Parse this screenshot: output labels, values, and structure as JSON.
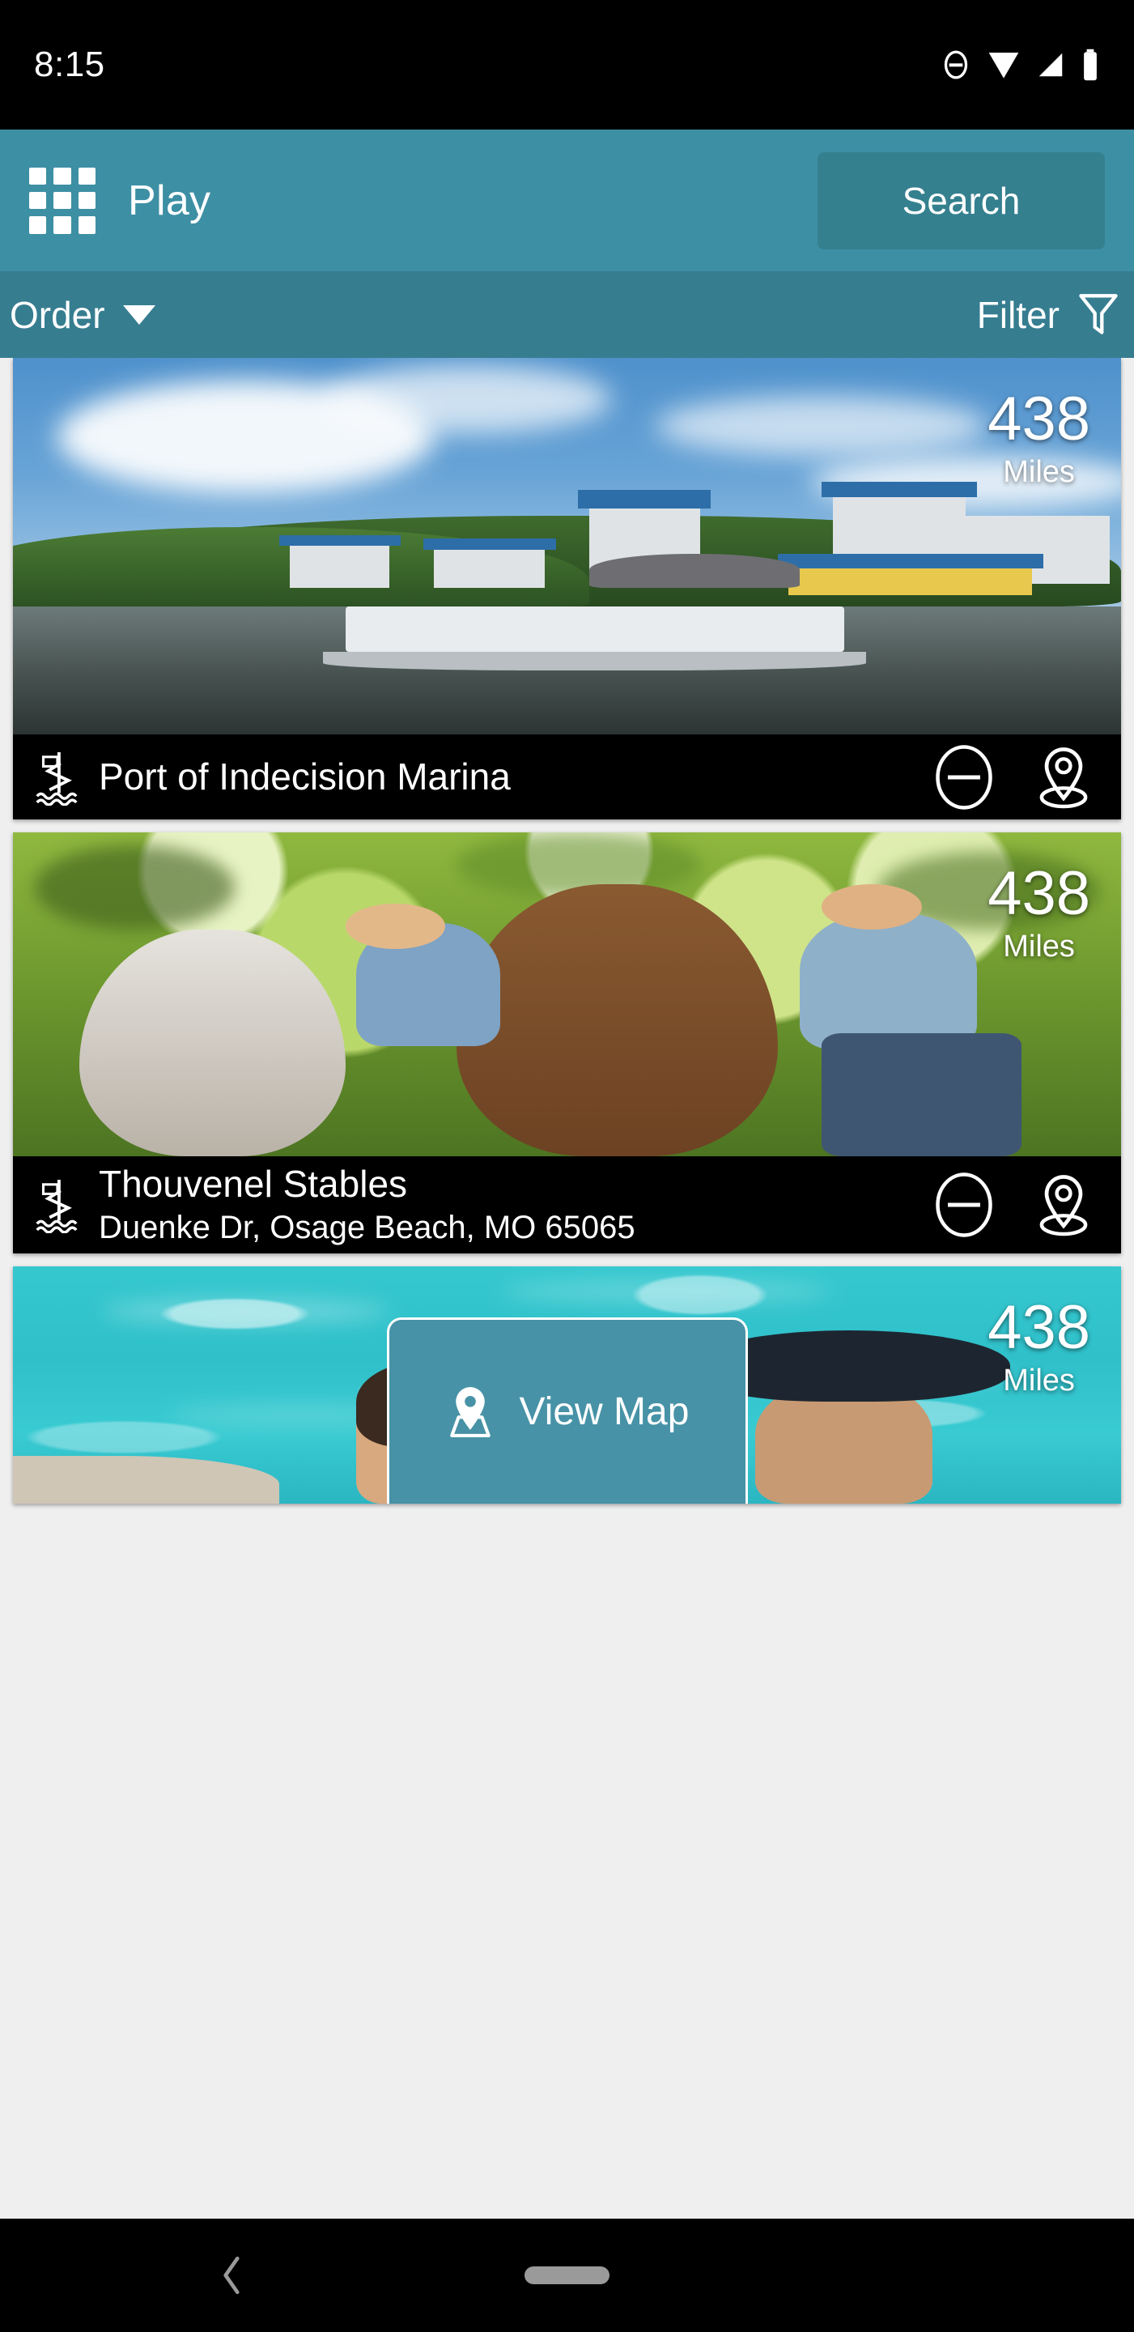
{
  "status_bar": {
    "time": "8:15",
    "icons": [
      "do-not-disturb-icon",
      "wifi-icon",
      "signal-icon",
      "battery-icon"
    ]
  },
  "app_bar": {
    "menu_icon": "grid-apps-icon",
    "title": "Play",
    "search_label": "Search",
    "background_color": "#3d8fa4"
  },
  "sub_bar": {
    "order_label": "Order",
    "order_icon": "caret-down-icon",
    "filter_label": "Filter",
    "filter_icon": "funnel-icon",
    "background_color": "#367d90"
  },
  "cards": [
    {
      "title": "Port of Indecision Marina",
      "subtitle": "",
      "distance_value": "438",
      "distance_unit": "Miles",
      "category_icon": "water-slide-icon",
      "remove_icon": "minus-circle-icon",
      "map_icon": "map-pin-icon",
      "photo_alt": "pontoon boat with passengers on lake in front of lakeside resort"
    },
    {
      "title": "Thouvenel Stables",
      "subtitle": "Duenke Dr, Osage Beach, MO 65065",
      "distance_value": "438",
      "distance_unit": "Miles",
      "category_icon": "water-slide-icon",
      "remove_icon": "minus-circle-icon",
      "map_icon": "map-pin-icon",
      "photo_alt": "man and woman riding horses on wooded trail"
    },
    {
      "title": "",
      "subtitle": "",
      "distance_value": "438",
      "distance_unit": "Miles",
      "category_icon": "",
      "remove_icon": "",
      "map_icon": "",
      "photo_alt": "two women in sunglasses and sun hat beside turquoise pool"
    }
  ],
  "view_map_button": {
    "label": "View Map",
    "icon": "map-pin-icon",
    "background_color": "#4792a6"
  },
  "nav_bar": {
    "back_icon": "chevron-left-icon",
    "home_icon": "home-pill-icon"
  }
}
